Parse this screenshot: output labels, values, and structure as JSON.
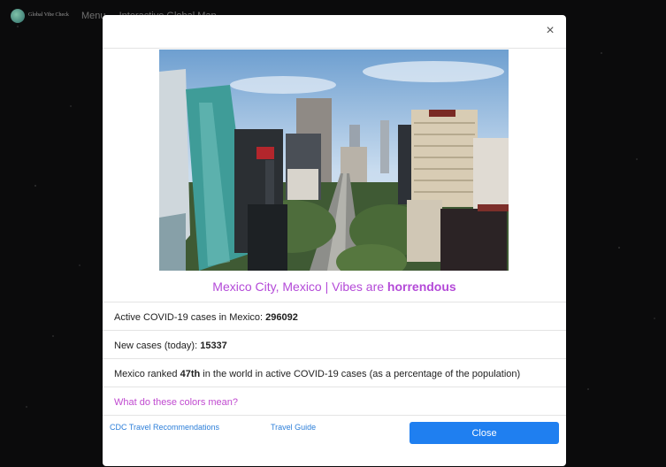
{
  "app": {
    "brand": "Global Vibe Check",
    "nav": [
      "Menu",
      "Interactive Global Map"
    ]
  },
  "modal": {
    "title": {
      "prefix": "Mexico City, Mexico | Vibes are ",
      "vibe": "horrendous"
    },
    "stats": {
      "active_label": "Active COVID-19 cases in Mexico: ",
      "active_value": "296092",
      "new_label": "New cases (today): ",
      "new_value": "15337",
      "rank_prefix": "Mexico ranked ",
      "rank_value": "47th",
      "rank_suffix": " in the world in active COVID-19 cases (as a percentage of the population)"
    },
    "colors_link": "What do these colors mean?",
    "footer": {
      "cdc_link": "CDC Travel Recommendations",
      "guide_link": "Travel Guide",
      "close_button": "Close"
    },
    "close_icon": "×"
  },
  "colors": {
    "accent": "#b44ad8",
    "primary_button": "#1f7ff0",
    "link": "#2d7fd9"
  }
}
